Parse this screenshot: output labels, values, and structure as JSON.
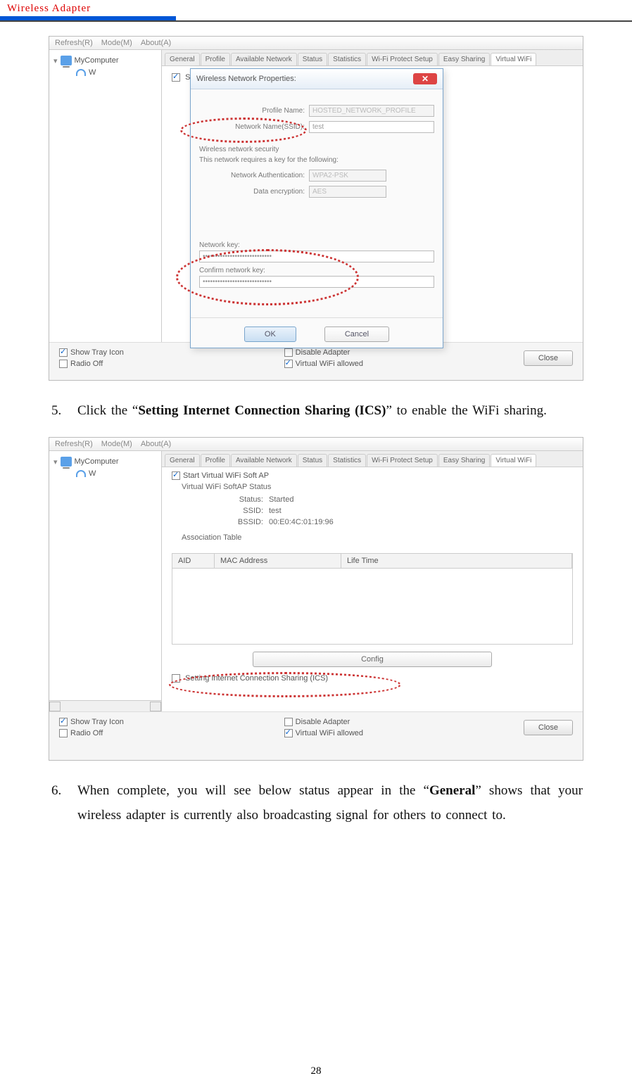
{
  "header": {
    "title": "Wireless  Adapter"
  },
  "page_number": "28",
  "steps": {
    "s5_num": "5",
    "s5_a": "Click the “",
    "s5_bold": "Setting Internet Connection Sharing (ICS)",
    "s5_b": "” to enable the WiFi sharing.",
    "s6_num": "6",
    "s6_a": "When complete, you will see below status appear in the “",
    "s6_bold": "General",
    "s6_b": "” shows that your wireless adapter is currently also broadcasting signal for others to connect to."
  },
  "common": {
    "menu_refresh": "Refresh(R)",
    "menu_mode": "Mode(M)",
    "menu_about": "About(A)",
    "tree_root": "MyComputer",
    "tree_w": "W",
    "tab_general": "General",
    "tab_profile": "Profile",
    "tab_avail": "Available Network",
    "tab_status": "Status",
    "tab_stats": "Statistics",
    "tab_wps": "Wi-Fi Protect Setup",
    "tab_easy": "Easy Sharing",
    "tab_virtual": "Virtual WiFi",
    "start_softap": "Start Virtual WiFi Soft AP",
    "show_tray": "Show Tray Icon",
    "radio_off": "Radio Off",
    "disable_adapter": "Disable Adapter",
    "vwifi_allowed": "Virtual WiFi allowed",
    "close": "Close"
  },
  "dialog": {
    "title": "Wireless Network Properties:",
    "profile_lbl": "Profile Name:",
    "profile_val": "HOSTED_NETWORK_PROFILE",
    "ssid_lbl": "Network Name(SSID):",
    "ssid_val": "test",
    "sec_hdr": "Wireless network security",
    "sec_sub": "This network requires a key for the following:",
    "auth_lbl": "Network Authentication:",
    "auth_val": "WPA2-PSK",
    "enc_lbl": "Data encryption:",
    "enc_val": "AES",
    "key_lbl": "Network key:",
    "key_val": "••••••••••••••••••••••••••••",
    "ckey_lbl": "Confirm network key:",
    "ok": "OK",
    "cancel": "Cancel"
  },
  "softap_status": {
    "heading": "Virtual WiFi SoftAP Status",
    "status_lbl": "Status:",
    "status_val": "Started",
    "ssid_lbl": "SSID:",
    "ssid_val": "test",
    "bssid_lbl": "BSSID:",
    "bssid_val": "00:E0:4C:01:19:96",
    "assoc_hdr": "Association Table",
    "col_aid": "AID",
    "col_mac": "MAC Address",
    "col_life": "Life Time",
    "config": "Config",
    "ics": "Setting Internet Connection Sharing (ICS)"
  }
}
